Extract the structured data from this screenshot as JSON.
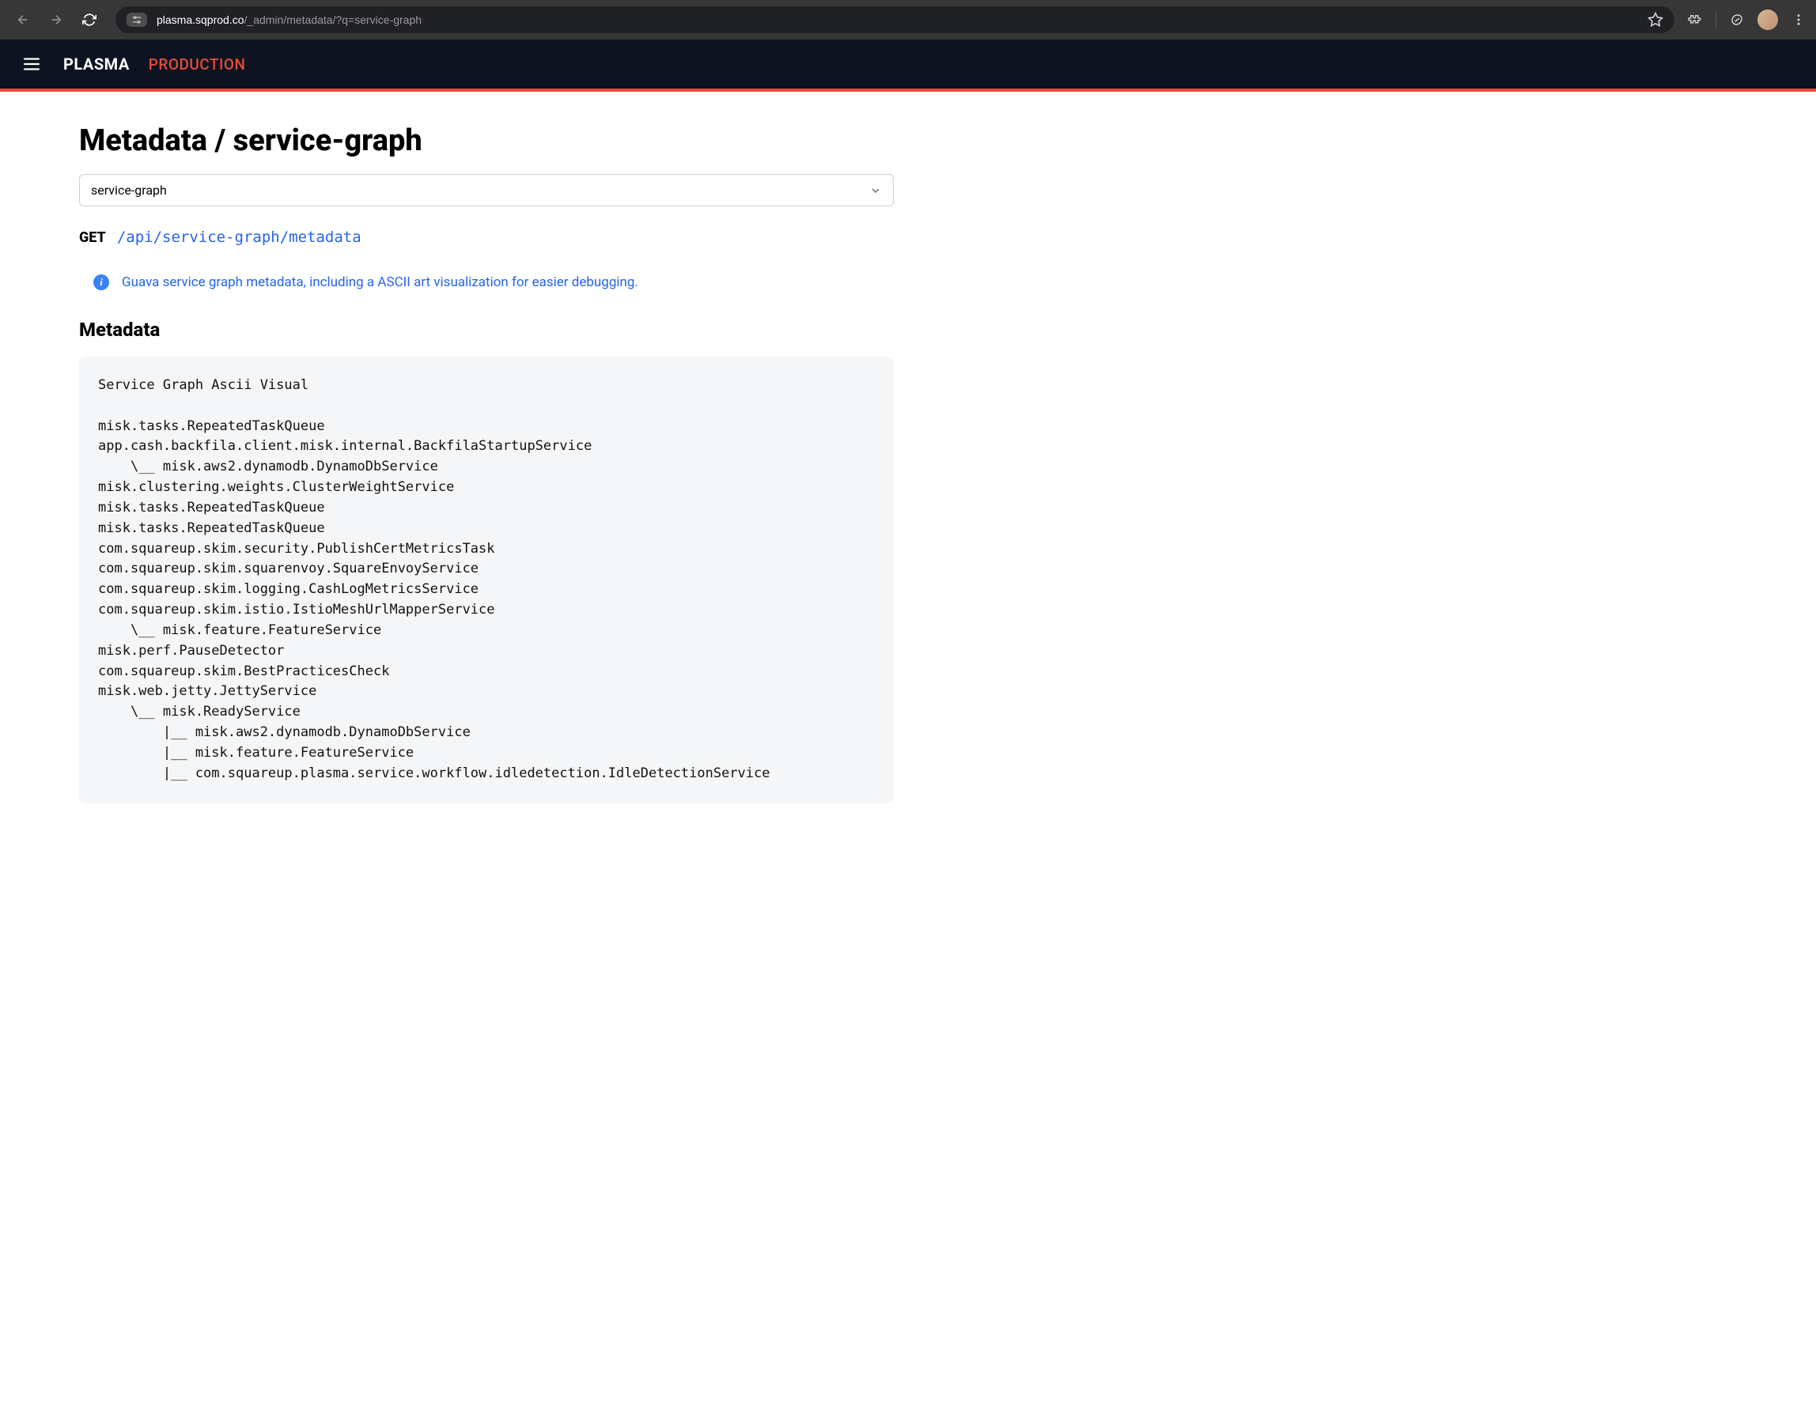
{
  "browser": {
    "url_host": "plasma.sqprod.co",
    "url_path": "/_admin/metadata/?q=service-graph"
  },
  "header": {
    "app_name": "PLASMA",
    "environment": "PRODUCTION"
  },
  "page": {
    "title": "Metadata / service-graph",
    "select_value": "service-graph",
    "method": "GET",
    "api_path": "/api/service-graph/metadata",
    "info_text": "Guava service graph metadata, including a ASCII art visualization for easier debugging.",
    "section_title": "Metadata",
    "code": "Service Graph Ascii Visual\n\nmisk.tasks.RepeatedTaskQueue\napp.cash.backfila.client.misk.internal.BackfilaStartupService\n    \\__ misk.aws2.dynamodb.DynamoDbService\nmisk.clustering.weights.ClusterWeightService\nmisk.tasks.RepeatedTaskQueue\nmisk.tasks.RepeatedTaskQueue\ncom.squareup.skim.security.PublishCertMetricsTask\ncom.squareup.skim.squarenvoy.SquareEnvoyService\ncom.squareup.skim.logging.CashLogMetricsService\ncom.squareup.skim.istio.IstioMeshUrlMapperService\n    \\__ misk.feature.FeatureService\nmisk.perf.PauseDetector\ncom.squareup.skim.BestPracticesCheck\nmisk.web.jetty.JettyService\n    \\__ misk.ReadyService\n        |__ misk.aws2.dynamodb.DynamoDbService\n        |__ misk.feature.FeatureService\n        |__ com.squareup.plasma.service.workflow.idledetection.IdleDetectionService"
  }
}
